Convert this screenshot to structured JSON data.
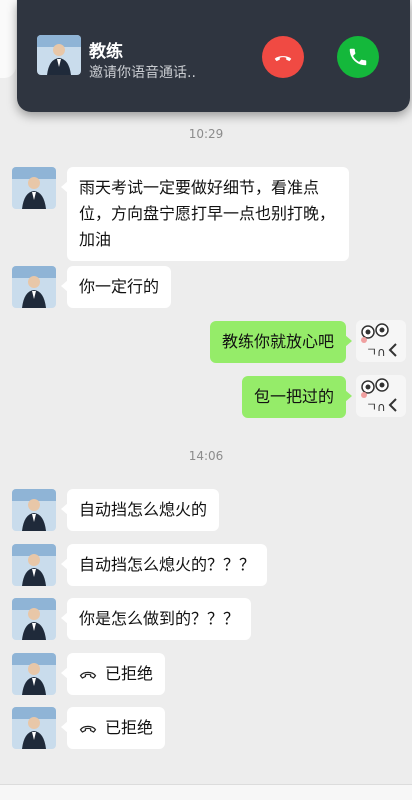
{
  "call": {
    "name": "教练",
    "subtitle": "邀请你语音通话..",
    "decline_icon": "phone-decline-icon",
    "accept_icon": "phone-accept-icon",
    "colors": {
      "banner": "#2f3540",
      "decline": "#f04a43",
      "accept": "#14b83b"
    }
  },
  "timestamps": [
    "10:29",
    "14:06"
  ],
  "messages": [
    {
      "side": "left",
      "text": "雨天考试一定要做好细节，看准点位，方向盘宁愿打早一点也别打晚，加油"
    },
    {
      "side": "left",
      "text": "你一定行的"
    },
    {
      "side": "right",
      "text": "教练你就放心吧"
    },
    {
      "side": "right",
      "text": "包一把过的"
    },
    {
      "side": "left",
      "text": "自动挡怎么熄火的"
    },
    {
      "side": "left",
      "text": "自动挡怎么熄火的？？？"
    },
    {
      "side": "left",
      "text": "你是怎么做到的？？？"
    },
    {
      "side": "left",
      "text": "已拒绝"
    },
    {
      "side": "left",
      "text": "已拒绝"
    }
  ],
  "colors": {
    "chat_bg": "#ededed",
    "bubble_self": "#95ec69",
    "bubble_other": "#ffffff"
  }
}
